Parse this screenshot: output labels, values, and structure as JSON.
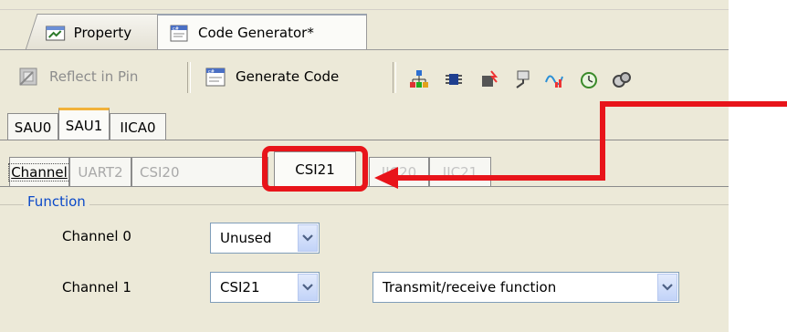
{
  "doc_tabs": [
    {
      "label": "Property",
      "icon": "property-icon"
    },
    {
      "label": "Code Generator*",
      "icon": "code-generator-icon"
    }
  ],
  "toolbar": {
    "reflect_label": "Reflect in Pin",
    "generate_label": "Generate Code",
    "icons": [
      "clock-generator-icon",
      "port-icon",
      "interrupt-icon",
      "serial-icon",
      "analog-icon",
      "timer-icon",
      "watchdog-icon"
    ]
  },
  "unit_tabs": [
    "SAU0",
    "SAU1",
    "IICA0"
  ],
  "unit_active": "SAU1",
  "channel_tabs": [
    "Channel",
    "UART2",
    "CSI20",
    "CSI21",
    "IIC20",
    "IIC21"
  ],
  "channel_active": "CSI21",
  "function": {
    "title": "Function",
    "channel0_label": "Channel 0",
    "channel0_value": "Unused",
    "channel1_label": "Channel 1",
    "channel1_value": "CSI21",
    "channel1_mode": "Transmit/receive function"
  },
  "colors": {
    "highlight": "#e8141a",
    "group_title": "#0b49c9",
    "active_tab_accent": "#f2b23a"
  }
}
